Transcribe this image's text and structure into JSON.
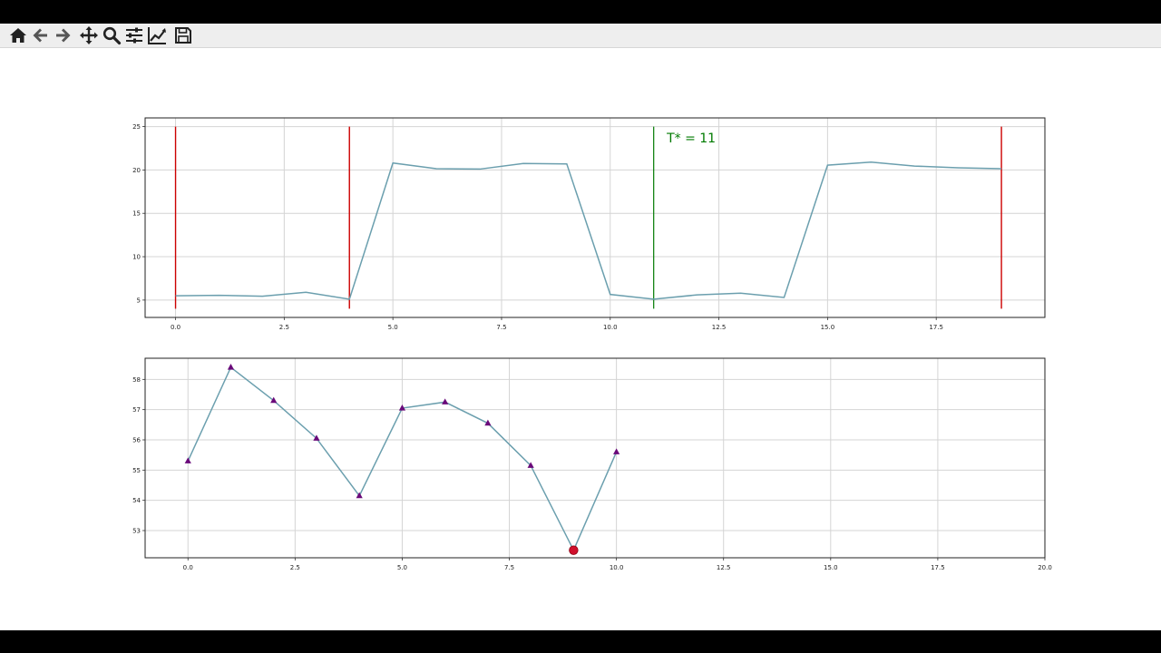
{
  "toolbar": {
    "items": [
      {
        "name": "home-button",
        "icon": "home-icon"
      },
      {
        "name": "back-button",
        "icon": "arrow-left-icon"
      },
      {
        "name": "forward-button",
        "icon": "arrow-right-icon"
      },
      {
        "name": "pan-button",
        "icon": "move-icon"
      },
      {
        "name": "zoom-button",
        "icon": "magnifier-icon"
      },
      {
        "name": "configure-subplots-button",
        "icon": "sliders-icon"
      },
      {
        "name": "edit-axis-button",
        "icon": "line-chart-icon"
      },
      {
        "name": "save-button",
        "icon": "floppy-disk-icon"
      }
    ]
  },
  "colors": {
    "line": "#6b9fae",
    "vline_red": "#cc0000",
    "vline_green": "#007a00",
    "annotation": "#007a00",
    "marker_triangle": "#6a0a7a",
    "marker_min": "#d0102c",
    "grid": "#d4d4d4"
  },
  "chart_data": [
    {
      "type": "line",
      "x": [
        0,
        1,
        2,
        3,
        4,
        5,
        6,
        7,
        8,
        9,
        10,
        11,
        12,
        13,
        14,
        15,
        16,
        17,
        18,
        19
      ],
      "series": [
        {
          "values": [
            5.5,
            5.55,
            5.45,
            5.9,
            5.1,
            20.8,
            20.15,
            20.1,
            20.75,
            20.7,
            5.65,
            5.1,
            5.6,
            5.8,
            5.3,
            20.55,
            20.9,
            20.45,
            20.25,
            20.15
          ]
        }
      ],
      "xlim": [
        -0.7,
        20.0
      ],
      "ylim": [
        3.0,
        26.0
      ],
      "xticks": [
        0.0,
        2.5,
        5.0,
        7.5,
        10.0,
        12.5,
        15.0,
        17.5
      ],
      "xtick_labels": [
        "0.0",
        "2.5",
        "5.0",
        "7.5",
        "10.0",
        "12.5",
        "15.0",
        "17.5"
      ],
      "yticks": [
        5,
        10,
        15,
        20,
        25
      ],
      "ytick_labels": [
        "5",
        "10",
        "15",
        "20",
        "25"
      ],
      "vlines_red": [
        0,
        4,
        19
      ],
      "vline_green": 11,
      "vline_range": [
        4.0,
        25.0
      ],
      "annotation": {
        "text": "T* = 11",
        "x": 11.3,
        "y": 23.2
      },
      "grid": true
    },
    {
      "type": "line",
      "x": [
        0,
        1,
        2,
        3,
        4,
        5,
        6,
        7,
        8,
        9,
        10
      ],
      "series": [
        {
          "values": [
            55.3,
            58.4,
            57.3,
            56.05,
            54.15,
            57.05,
            57.25,
            56.55,
            55.15,
            52.35,
            55.6
          ],
          "marker": "triangle"
        }
      ],
      "min_point": {
        "x": 9,
        "y": 52.35
      },
      "xlim": [
        -1.0,
        20.0
      ],
      "ylim": [
        52.1,
        58.7
      ],
      "xticks": [
        0.0,
        2.5,
        5.0,
        7.5,
        10.0,
        12.5,
        15.0,
        17.5,
        20.0
      ],
      "xtick_labels": [
        "0.0",
        "2.5",
        "5.0",
        "7.5",
        "10.0",
        "12.5",
        "15.0",
        "17.5",
        "20.0"
      ],
      "yticks": [
        53,
        54,
        55,
        56,
        57,
        58
      ],
      "ytick_labels": [
        "53",
        "54",
        "55",
        "56",
        "57",
        "58"
      ],
      "grid": true
    }
  ]
}
